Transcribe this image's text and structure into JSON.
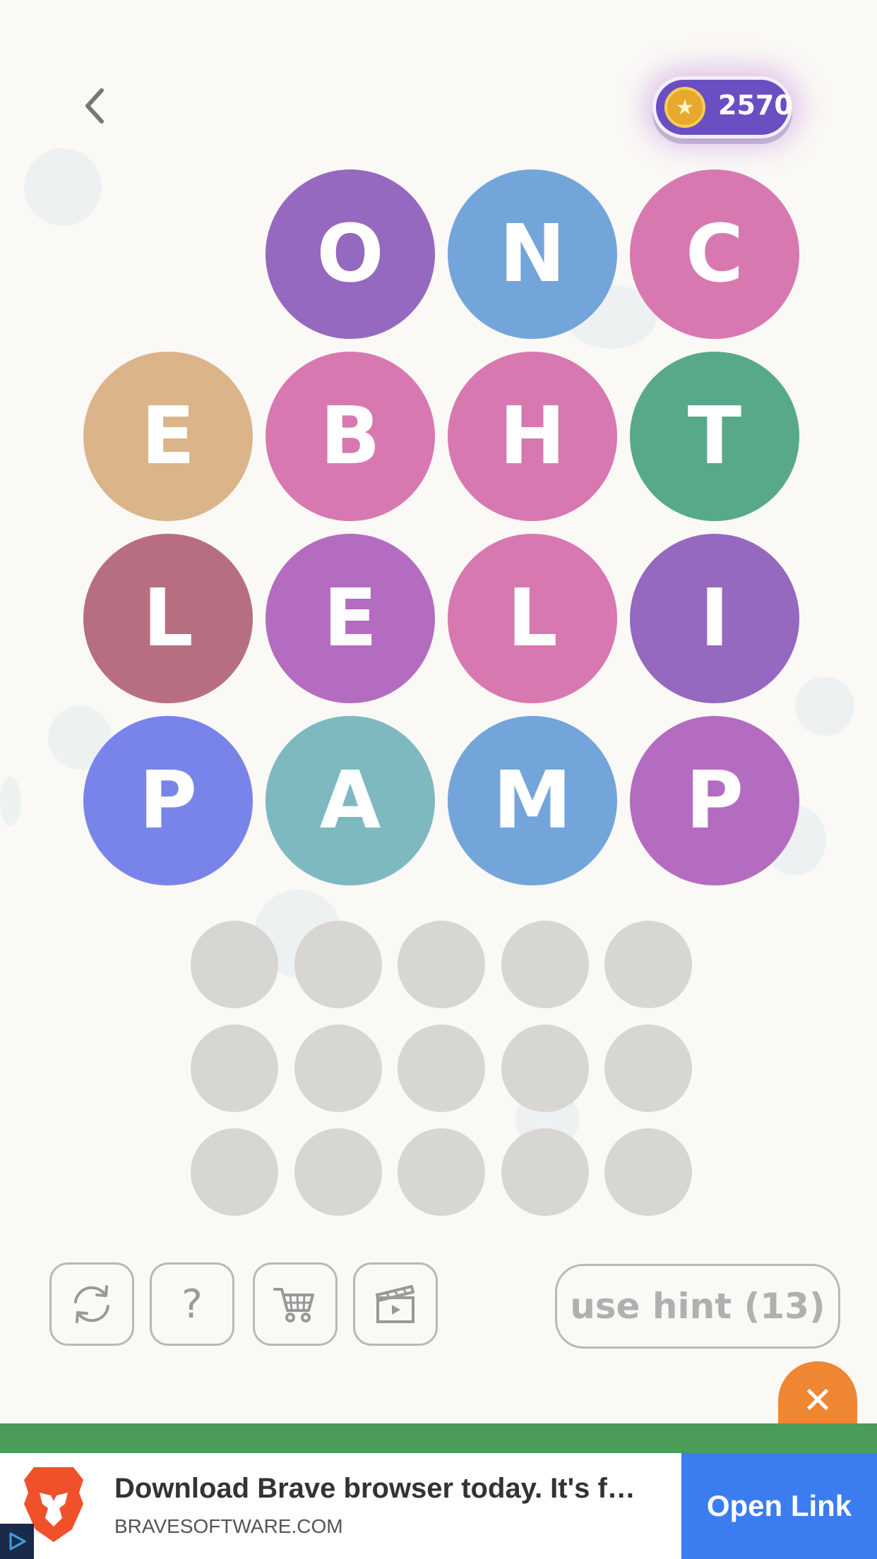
{
  "header": {
    "back_icon": "chevron-left-icon",
    "coins": "2570",
    "coin_icon": "star-coin-icon"
  },
  "board": {
    "rows": [
      [
        null,
        {
          "letter": "O",
          "color": "#9569bf"
        },
        {
          "letter": "N",
          "color": "#73a5db"
        },
        {
          "letter": "C",
          "color": "#d878b0"
        }
      ],
      [
        {
          "letter": "E",
          "color": "#dcb489"
        },
        {
          "letter": "B",
          "color": "#d878b0"
        },
        {
          "letter": "H",
          "color": "#d878b0"
        },
        {
          "letter": "T",
          "color": "#58a989"
        }
      ],
      [
        {
          "letter": "L",
          "color": "#b86e81"
        },
        {
          "letter": "E",
          "color": "#b46cc0"
        },
        {
          "letter": "L",
          "color": "#d878b0"
        },
        {
          "letter": "I",
          "color": "#9569bf"
        }
      ],
      [
        {
          "letter": "P",
          "color": "#7984eb"
        },
        {
          "letter": "A",
          "color": "#7eb9c0"
        },
        {
          "letter": "M",
          "color": "#73a5db"
        },
        {
          "letter": "P",
          "color": "#b46cc0"
        }
      ]
    ]
  },
  "answer_slots": {
    "rows": 3,
    "cols": 5
  },
  "toolbar": {
    "shuffle_icon": "refresh-icon",
    "help_label": "?",
    "shop_icon": "cart-icon",
    "video_icon": "clapperboard-icon",
    "hint_label": "use hint (13)"
  },
  "ad": {
    "title": "Download Brave browser today. It's f…",
    "domain": "BRAVESOFTWARE.COM",
    "button_label": "Open Link",
    "close_label": "✕",
    "logo_icon": "brave-lion-logo",
    "badge_icon": "ad-choices-icon"
  }
}
